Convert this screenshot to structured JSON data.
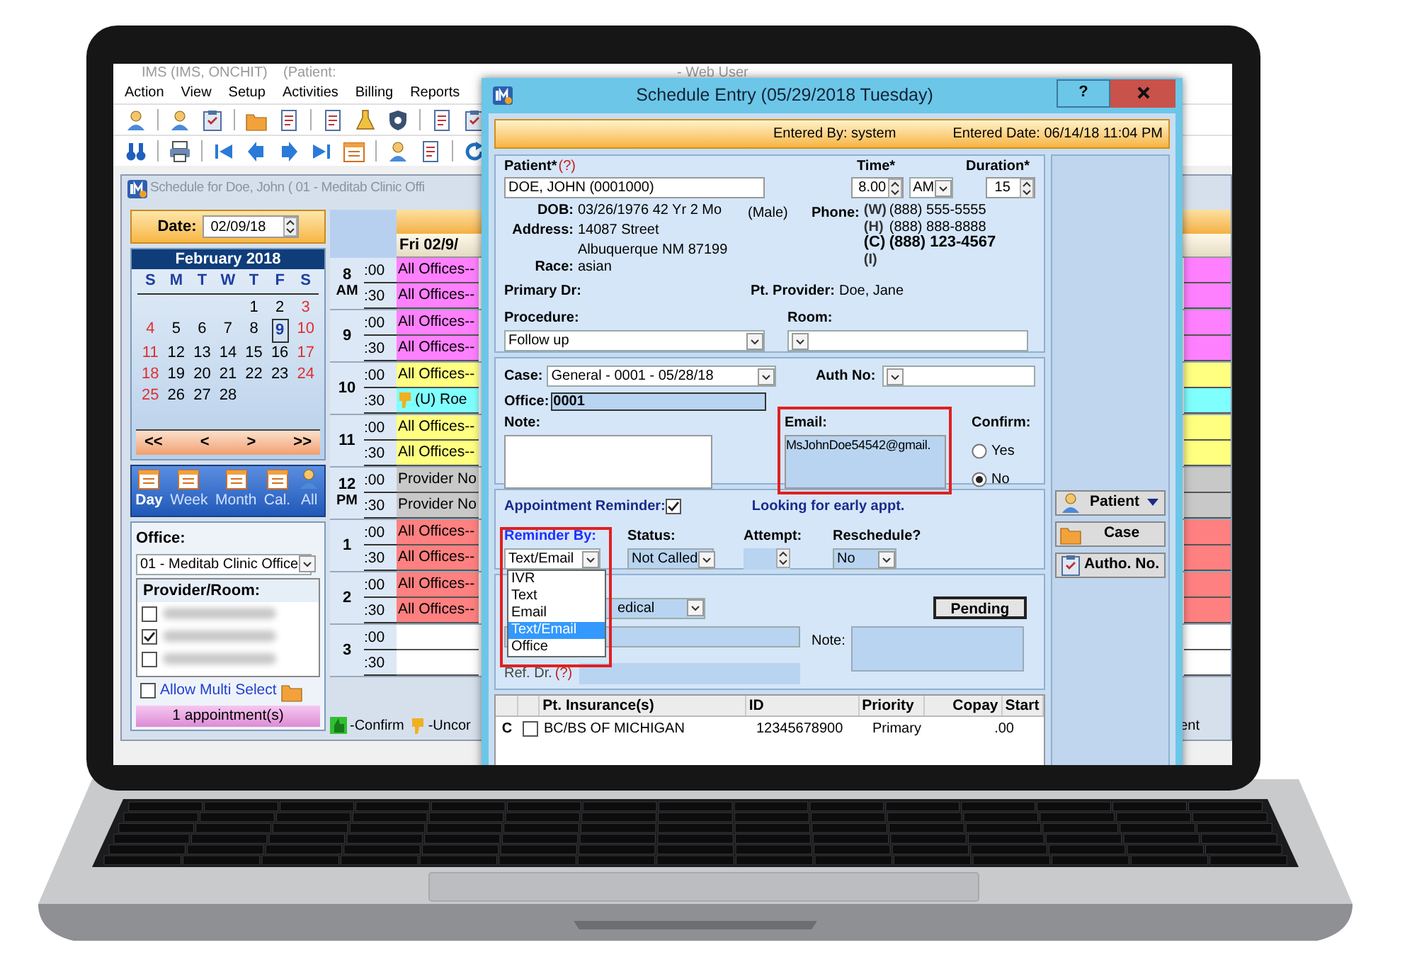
{
  "app": {
    "title": "IMS (IMS, ONCHIT)",
    "patient_label": "(Patient:",
    "user": "- Web User",
    "menu": [
      "Action",
      "View",
      "Setup",
      "Activities",
      "Billing",
      "Reports"
    ]
  },
  "schedule": {
    "title": "Schedule for Doe, John  ( 01 - Meditab Clinic Offi",
    "date_label": "Date:",
    "date": "02/09/18",
    "calendar": {
      "month": "February 2018",
      "weekdays": [
        "S",
        "M",
        "T",
        "W",
        "T",
        "F",
        "S"
      ],
      "days": [
        {
          "kind": "blank"
        },
        {
          "kind": "blank"
        },
        {
          "kind": "blank"
        },
        {
          "kind": "blank"
        },
        {
          "kind": "day",
          "label": "1",
          "selected": false
        },
        {
          "kind": "day",
          "label": "2",
          "selected": false
        },
        {
          "kind": "day",
          "label": "3",
          "selected": false
        },
        {
          "kind": "day",
          "label": "4",
          "selected": false
        },
        {
          "kind": "day",
          "label": "5",
          "selected": false
        },
        {
          "kind": "day",
          "label": "6",
          "selected": false
        },
        {
          "kind": "day",
          "label": "7",
          "selected": false
        },
        {
          "kind": "day",
          "label": "8",
          "selected": false
        },
        {
          "kind": "day",
          "label": "9",
          "selected": true
        },
        {
          "kind": "day",
          "label": "10",
          "selected": false
        },
        {
          "kind": "day",
          "label": "11",
          "selected": false
        },
        {
          "kind": "day",
          "label": "12",
          "selected": false
        },
        {
          "kind": "day",
          "label": "13",
          "selected": false
        },
        {
          "kind": "day",
          "label": "14",
          "selected": false
        },
        {
          "kind": "day",
          "label": "15",
          "selected": false
        },
        {
          "kind": "day",
          "label": "16",
          "selected": false
        },
        {
          "kind": "day",
          "label": "17",
          "selected": false
        },
        {
          "kind": "day",
          "label": "18",
          "selected": false
        },
        {
          "kind": "day",
          "label": "19",
          "selected": false
        },
        {
          "kind": "day",
          "label": "20",
          "selected": false
        },
        {
          "kind": "day",
          "label": "21",
          "selected": false
        },
        {
          "kind": "day",
          "label": "22",
          "selected": false
        },
        {
          "kind": "day",
          "label": "23",
          "selected": false
        },
        {
          "kind": "day",
          "label": "24",
          "selected": false
        },
        {
          "kind": "day",
          "label": "25",
          "selected": false
        },
        {
          "kind": "day",
          "label": "26",
          "selected": false
        },
        {
          "kind": "day",
          "label": "27",
          "selected": false
        },
        {
          "kind": "day",
          "label": "28",
          "selected": false
        }
      ]
    },
    "nav": [
      "<<",
      "<",
      ">",
      ">>"
    ],
    "views": [
      {
        "label": "Day",
        "selected": true
      },
      {
        "label": "Week",
        "selected": false
      },
      {
        "label": "Month",
        "selected": false
      },
      {
        "label": "Cal.",
        "selected": false
      },
      {
        "label": "All",
        "selected": false
      }
    ],
    "office_label": "Office:",
    "office": "01 - Meditab Clinic Office",
    "provider_label": "Provider/Room:",
    "providers": [
      {
        "checked": false
      },
      {
        "checked": true
      },
      {
        "checked": false
      }
    ],
    "multi_select": {
      "label": "Allow Multi Select",
      "checked": false
    },
    "appointments_count": "1 appointment(s)",
    "day_header": "Fri 02/9/",
    "hours": [
      {
        "label": "8",
        "period": "AM",
        "slots": [
          {
            "minute": ":00",
            "kind": "block",
            "text": "All Offices--",
            "color": "#ff80ff"
          },
          {
            "minute": ":30",
            "kind": "block",
            "text": "All Offices--",
            "color": "#ff80ff"
          }
        ]
      },
      {
        "label": "9",
        "slots": [
          {
            "minute": ":00",
            "kind": "block",
            "text": "All Offices--",
            "color": "#ff80ff"
          },
          {
            "minute": ":30",
            "kind": "block",
            "text": "All Offices--",
            "color": "#ff80ff"
          }
        ]
      },
      {
        "label": "10",
        "slots": [
          {
            "minute": ":00",
            "kind": "block",
            "text": "All Offices--",
            "color": "#ffff80"
          },
          {
            "minute": ":30",
            "kind": "appointment",
            "text": "(U)  Roe",
            "color": "#80ffff"
          }
        ]
      },
      {
        "label": "11",
        "slots": [
          {
            "minute": ":00",
            "kind": "block",
            "text": "All Offices--",
            "color": "#ffff80"
          },
          {
            "minute": ":30",
            "kind": "block",
            "text": "All Offices--",
            "color": "#ffff80"
          }
        ]
      },
      {
        "label": "12",
        "period": "PM",
        "slots": [
          {
            "minute": ":00",
            "kind": "block",
            "text": "Provider No",
            "color": "#c8c8c8"
          },
          {
            "minute": ":30",
            "kind": "block",
            "text": "Provider No",
            "color": "#c8c8c8"
          }
        ]
      },
      {
        "label": "1",
        "slots": [
          {
            "minute": ":00",
            "kind": "block",
            "text": "All Offices--",
            "color": "#ff8080"
          },
          {
            "minute": ":30",
            "kind": "block",
            "text": "All Offices--",
            "color": "#ff8080"
          }
        ]
      },
      {
        "label": "2",
        "slots": [
          {
            "minute": ":00",
            "kind": "block",
            "text": "All Offices--",
            "color": "#ff8080"
          },
          {
            "minute": ":30",
            "kind": "block",
            "text": "All Offices--",
            "color": "#ff8080"
          }
        ]
      },
      {
        "label": "3",
        "slots": [
          {
            "minute": ":00",
            "kind": "empty",
            "color": "#ffffff"
          },
          {
            "minute": ":30",
            "kind": "empty",
            "color": "#ffffff"
          }
        ]
      }
    ],
    "legend": [
      {
        "kind": "confirm",
        "label": "-Confirm"
      },
      {
        "kind": "unconfirm",
        "label": "-Uncor"
      }
    ],
    "legend_tail": "ent"
  },
  "dialog": {
    "title": "Schedule Entry (05/29/2018 Tuesday)",
    "help": "?",
    "entered_by": "Entered By:  system",
    "entered_date": "Entered Date: 06/14/18 11:04 PM",
    "patient": {
      "label": "Patient*",
      "hint": "(?)",
      "value": "DOE, JOHN  (0001000)"
    },
    "time": {
      "label": "Time*",
      "value": "8.00",
      "period": "AM"
    },
    "duration": {
      "label": "Duration*",
      "value": "15"
    },
    "dob": {
      "label": "DOB:",
      "value": "03/26/1976  42 Yr 2 Mo",
      "sex": "(Male)"
    },
    "address": {
      "label": "Address:",
      "lines": [
        "14087 Street",
        "Albuquerque  NM  87199"
      ]
    },
    "race": {
      "label": "Race:",
      "value": "asian"
    },
    "phone": {
      "label": "Phone:",
      "numbers": [
        {
          "type": "(W)",
          "number": "(888) 555-5555",
          "emphasized": false
        },
        {
          "type": "(H)",
          "number": "(888) 888-8888",
          "emphasized": false
        },
        {
          "type": "(C)",
          "number": "(888) 123-4567",
          "emphasized": true
        },
        {
          "type": "(I)",
          "emphasized": false
        }
      ]
    },
    "primary_dr": {
      "label": "Primary Dr:"
    },
    "pt_provider": {
      "label": "Pt. Provider:",
      "value": "Doe, Jane"
    },
    "procedure": {
      "label": "Procedure:",
      "value": "Follow up"
    },
    "room": {
      "label": "Room:"
    },
    "case": {
      "label": "Case:",
      "value": "General  -  0001 - 05/28/18"
    },
    "auth_no": {
      "label": "Auth No:"
    },
    "office": {
      "label": "Office:",
      "value": "0001"
    },
    "note": {
      "label": "Note:"
    },
    "email": {
      "label": "Email:",
      "value": "MsJohnDoe54542@gmail."
    },
    "confirm": {
      "label": "Confirm:",
      "options": [
        {
          "label": "Yes",
          "selected": false
        },
        {
          "label": "No",
          "selected": true
        }
      ]
    },
    "reminder": {
      "label": "Appointment Reminder:",
      "checked": true,
      "early_appt": "Looking for early appt.",
      "reminder_by": {
        "label": "Reminder By:",
        "value": "Text/Email",
        "options": [
          {
            "label": "IVR",
            "selected": false
          },
          {
            "label": "Text",
            "selected": false
          },
          {
            "label": "Email",
            "selected": false
          },
          {
            "label": "Text/Email",
            "selected": true
          },
          {
            "label": "Office",
            "selected": false
          }
        ]
      },
      "status": {
        "label": "Status:",
        "value": "Not Called"
      },
      "attempt": {
        "label": "Attempt:"
      },
      "reschedule": {
        "label": "Reschedule?",
        "value": "No"
      }
    },
    "visit": {
      "type_value": "edical",
      "status_button": "Pending",
      "note_label": "Note:",
      "ref_dr": {
        "label": "Ref. Dr.",
        "hint": "(?)"
      }
    },
    "insurance": {
      "columns": [
        "Pt. Insurance(s)",
        "ID",
        "Priority",
        "Copay",
        "Start"
      ],
      "rows": [
        {
          "marker": "C",
          "checked": false,
          "cells": [
            "BC/BS OF MICHIGAN",
            "12345678900",
            "Primary",
            ".00"
          ]
        }
      ]
    },
    "side_buttons": [
      {
        "kind": "patient",
        "label": "Patient"
      },
      {
        "kind": "case",
        "label": "Case"
      },
      {
        "kind": "auth",
        "label": "Autho. No."
      }
    ]
  }
}
